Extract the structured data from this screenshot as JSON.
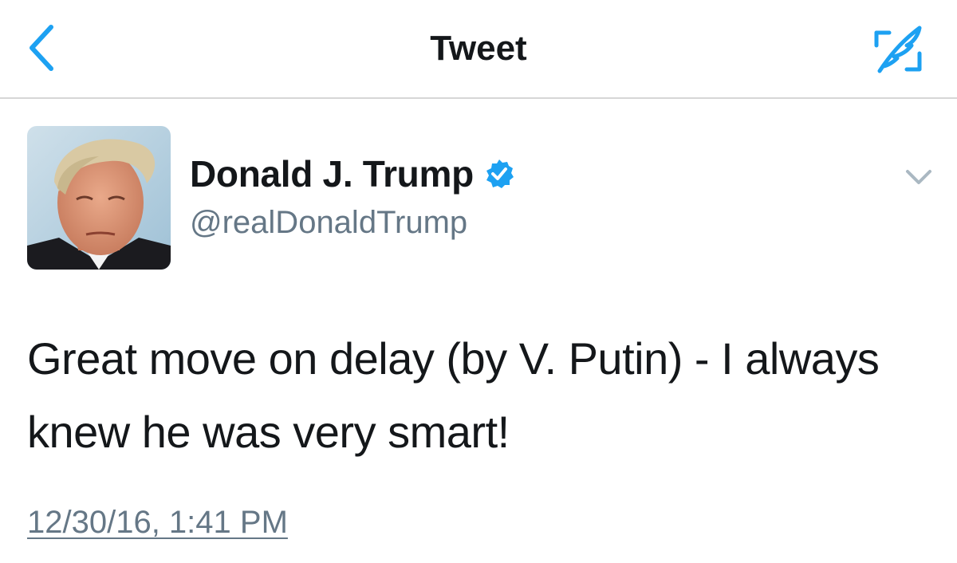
{
  "nav": {
    "title": "Tweet",
    "back_icon": "chevron-left-icon",
    "compose_icon": "compose-tweet-icon",
    "accent_color": "#1da1f2"
  },
  "tweet": {
    "author": {
      "name": "Donald J. Trump",
      "handle": "@realDonaldTrump",
      "verified": true,
      "avatar_icon": "profile-photo",
      "verified_icon": "verified-badge-icon"
    },
    "menu_icon": "chevron-down-icon",
    "text": "Great move on delay (by V. Putin) - I always knew he was very smart!",
    "timestamp": "12/30/16, 1:41 PM"
  },
  "colors": {
    "text_primary": "#14171a",
    "text_secondary": "#657786",
    "verified_blue": "#1da1f2",
    "divider": "#d6d6d6"
  }
}
